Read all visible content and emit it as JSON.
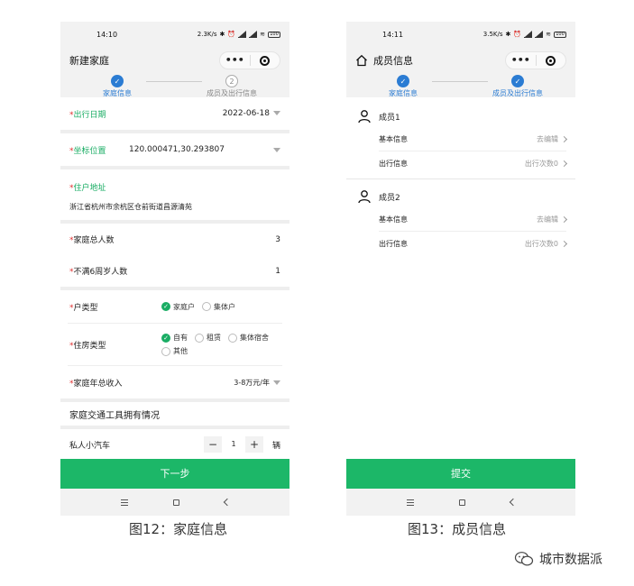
{
  "left": {
    "status": {
      "time": "14:10",
      "speed": "2.3K/s",
      "battery": "100"
    },
    "nav": {
      "title": "新建家庭",
      "more": "•••"
    },
    "steps": [
      {
        "label": "家庭信息",
        "marker": "✓",
        "state": "done"
      },
      {
        "label": "成员及出行信息",
        "marker": "2",
        "state": "todo"
      }
    ],
    "travel_date": {
      "label": "出行日期",
      "value": "2022-06-18"
    },
    "coords": {
      "label": "坐标位置",
      "value": "120.000471,30.293807"
    },
    "address": {
      "label": "住户地址",
      "value": "浙江省杭州市余杭区仓前街道昌源清苑"
    },
    "family_total": {
      "label": "家庭总人数",
      "value": "3"
    },
    "under6": {
      "label": "不满6周岁人数",
      "value": "1"
    },
    "household_type": {
      "label": "户类型",
      "options": [
        "家庭户",
        "集体户"
      ],
      "selected": "家庭户"
    },
    "housing_type": {
      "label": "住房类型",
      "options": [
        "自有",
        "租赁",
        "集体宿舍",
        "其他"
      ],
      "selected": "自有"
    },
    "income": {
      "label": "家庭年总收入",
      "value": "3-8万元/年"
    },
    "vehicles_title": "家庭交通工具拥有情况",
    "car": {
      "label": "私人小汽车",
      "minus": "−",
      "value": "1",
      "plus": "+",
      "unit": "辆"
    },
    "next_button": "下一步"
  },
  "right": {
    "status": {
      "time": "14:11",
      "speed": "3.5K/s",
      "battery": "100"
    },
    "nav": {
      "title": "成员信息",
      "more": "•••"
    },
    "steps": [
      {
        "label": "家庭信息",
        "marker": "✓",
        "state": "done"
      },
      {
        "label": "成员及出行信息",
        "marker": "✓",
        "state": "done"
      }
    ],
    "members": [
      {
        "name": "成员1",
        "basic_label": "基本信息",
        "basic_action": "去编辑",
        "trip_label": "出行信息",
        "trip_action": "出行次数0"
      },
      {
        "name": "成员2",
        "basic_label": "基本信息",
        "basic_action": "去编辑",
        "trip_label": "出行信息",
        "trip_action": "出行次数0"
      }
    ],
    "submit_button": "提交"
  },
  "captions": {
    "left": "图12：家庭信息",
    "right": "图13：成员信息"
  },
  "brand": "城市数据派",
  "colors": {
    "primary_green": "#1cb768",
    "step_blue": "#2b7cd3",
    "required_red": "#e03030"
  }
}
